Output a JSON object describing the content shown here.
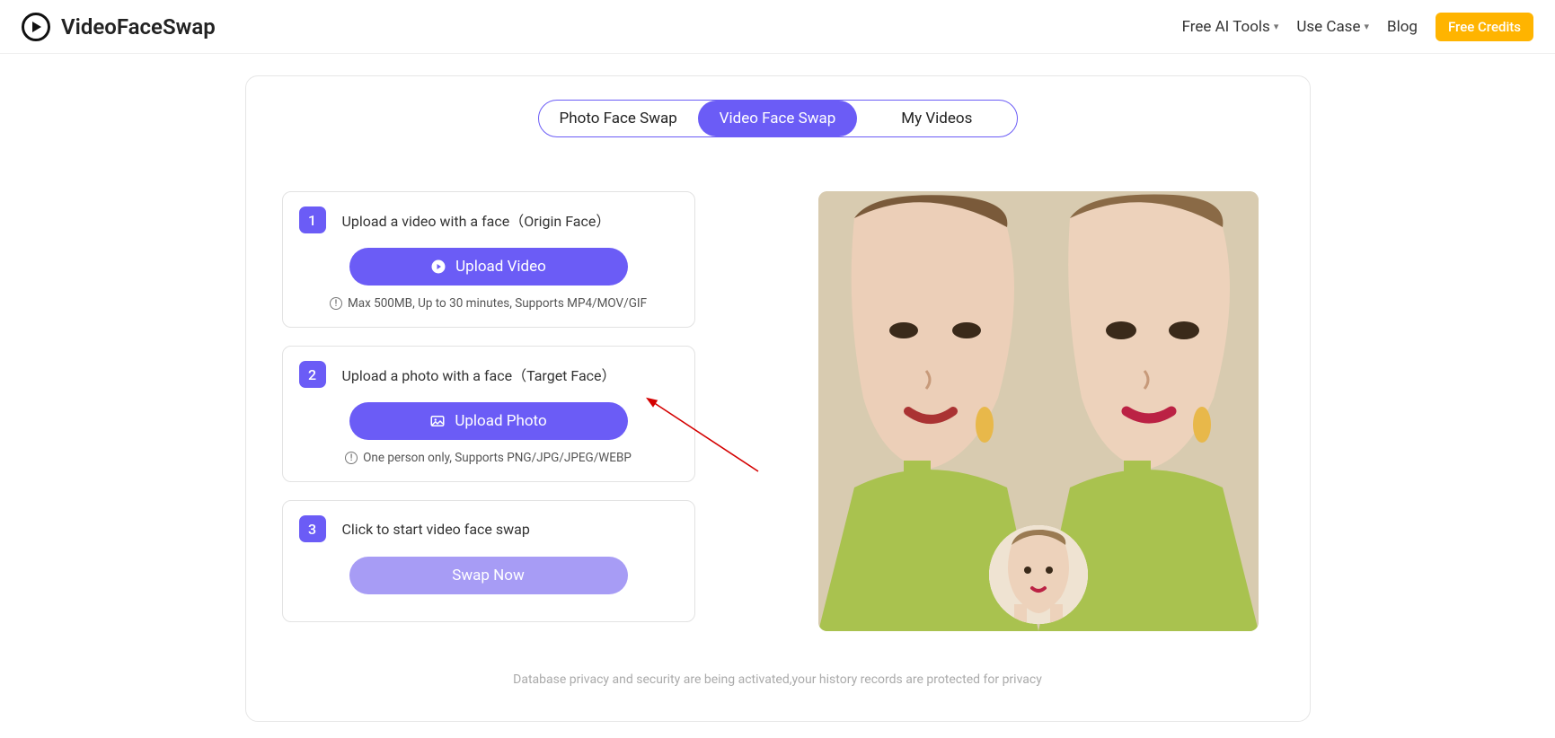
{
  "header": {
    "brand": "VideoFaceSwap",
    "nav": {
      "tools": "Free AI Tools",
      "usecase": "Use Case",
      "blog": "Blog",
      "credits": "Free Credits"
    }
  },
  "tabs": {
    "photo": "Photo Face Swap",
    "video": "Video Face Swap",
    "myvideos": "My Videos"
  },
  "steps": {
    "s1": {
      "num": "1",
      "title": "Upload a video with a face（Origin Face）",
      "action": "Upload Video",
      "meta": "Max 500MB, Up to 30 minutes, Supports MP4/MOV/GIF"
    },
    "s2": {
      "num": "2",
      "title": "Upload a photo with a face（Target Face）",
      "action": "Upload Photo",
      "meta": "One person only, Supports PNG/JPG/JPEG/WEBP"
    },
    "s3": {
      "num": "3",
      "title": "Click to start video face swap",
      "action": "Swap Now"
    }
  },
  "footer_privacy": "Database privacy and security are being activated,your history records are protected for privacy"
}
